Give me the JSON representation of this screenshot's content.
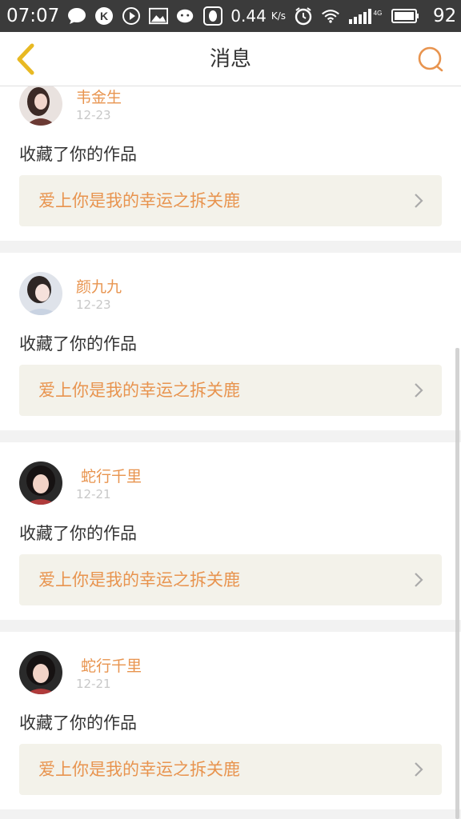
{
  "status_bar": {
    "time": "07:07",
    "speed": "0.44",
    "speed_unit": "K/s",
    "network": "4G",
    "battery": "92",
    "icons": [
      "chat-bubble-icon",
      "k-app-icon",
      "play-icon",
      "image-icon",
      "wechat-icon",
      "qq-icon",
      "alarm-icon",
      "wifi-icon",
      "signal-icon",
      "battery-icon"
    ]
  },
  "header": {
    "title": "消息",
    "back_icon": "chevron-left-icon",
    "search_icon": "search-icon"
  },
  "colors": {
    "accent": "#e8944f",
    "back": "#e8b923",
    "status_bar": "#3b3b3b",
    "card_link_bg": "#f3f2ea"
  },
  "messages": [
    {
      "username": "韦金生",
      "date": "12-23",
      "action": "收藏了你的作品",
      "work": "爱上你是我的幸运之拆关鹿"
    },
    {
      "username": "颜九九",
      "date": "12-23",
      "action": "收藏了你的作品",
      "work": "爱上你是我的幸运之拆关鹿"
    },
    {
      "username": " 蛇行千里",
      "date": "12-21",
      "action": "收藏了你的作品",
      "work": "爱上你是我的幸运之拆关鹿"
    },
    {
      "username": " 蛇行千里",
      "date": "12-21",
      "action": "收藏了你的作品",
      "work": "爱上你是我的幸运之拆关鹿"
    }
  ]
}
